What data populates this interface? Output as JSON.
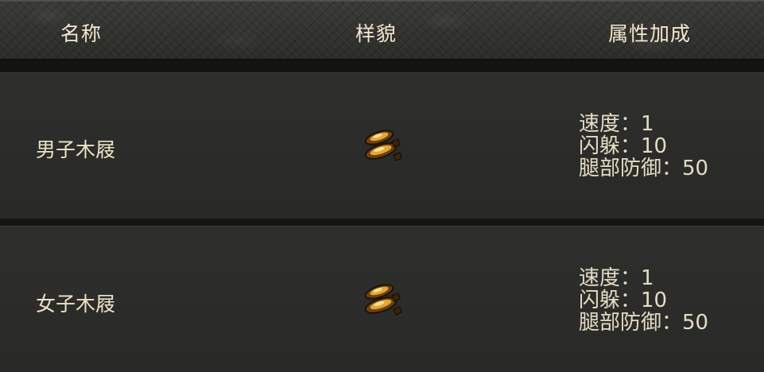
{
  "header": {
    "col_name": "名称",
    "col_appearance": "样貌",
    "col_attributes": "属性加成"
  },
  "rows": [
    {
      "name": "男子木屐",
      "icon": "wooden-clogs-icon",
      "attributes": [
        "速度：1",
        "闪躲：10",
        "腿部防御：50"
      ]
    },
    {
      "name": "女子木屐",
      "icon": "wooden-clogs-icon",
      "attributes": [
        "速度：1",
        "闪躲：10",
        "腿部防御：50"
      ]
    }
  ]
}
